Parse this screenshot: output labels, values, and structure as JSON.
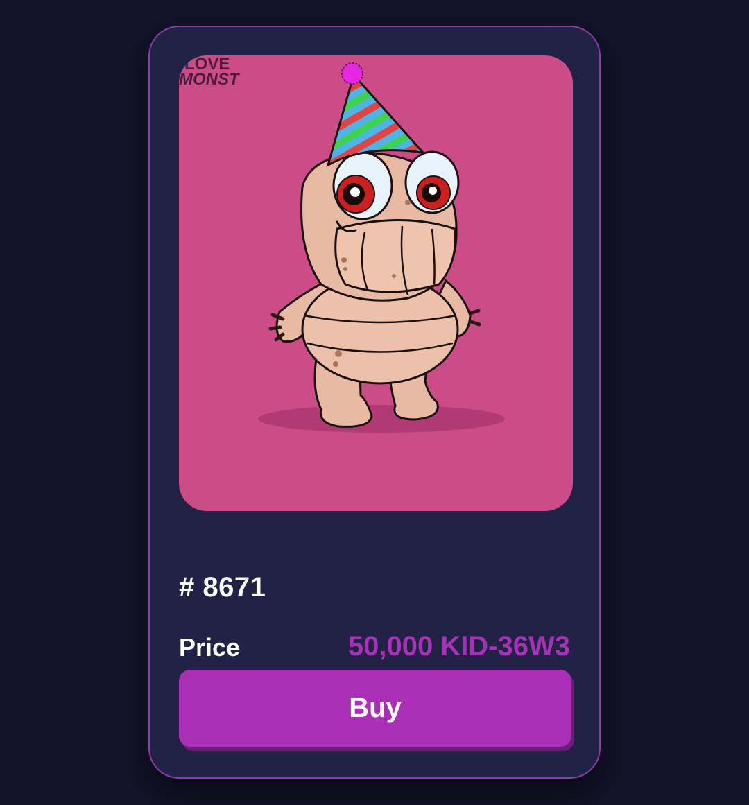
{
  "card": {
    "image_alt": "Love Monsters party hat monster",
    "watermark_line1": "LOVE",
    "watermark_line2": "MONST",
    "token_id": "# 8671",
    "price_label": "Price",
    "price_value": "50,000 KID-36W3",
    "buy_label": "Buy"
  },
  "colors": {
    "page_background": "#13132a",
    "card_background": "#222246",
    "card_border": "#8e3aa8",
    "art_background": "#cc4c88",
    "accent": "#a92fb6",
    "price_text": "#a533b5"
  }
}
